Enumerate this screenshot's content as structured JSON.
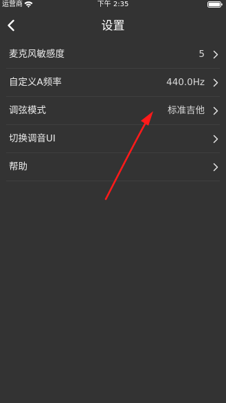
{
  "status_bar": {
    "carrier": "运营商",
    "time": "下午 2:35",
    "wifi_icon": "wifi-icon",
    "battery_icon": "battery-icon"
  },
  "nav": {
    "title": "设置",
    "back_icon": "chevron-left-icon"
  },
  "settings": [
    {
      "label": "麦克风敏感度",
      "value": "5"
    },
    {
      "label": "自定义A频率",
      "value": "440.0Hz"
    },
    {
      "label": "调弦模式",
      "value": "标准吉他"
    },
    {
      "label": "切换调音UI",
      "value": ""
    },
    {
      "label": "帮助",
      "value": ""
    }
  ],
  "colors": {
    "background": "#333333",
    "text": "#ffffff",
    "divider": "#3f3f3f",
    "annotation_arrow": "#ff1a1a"
  }
}
